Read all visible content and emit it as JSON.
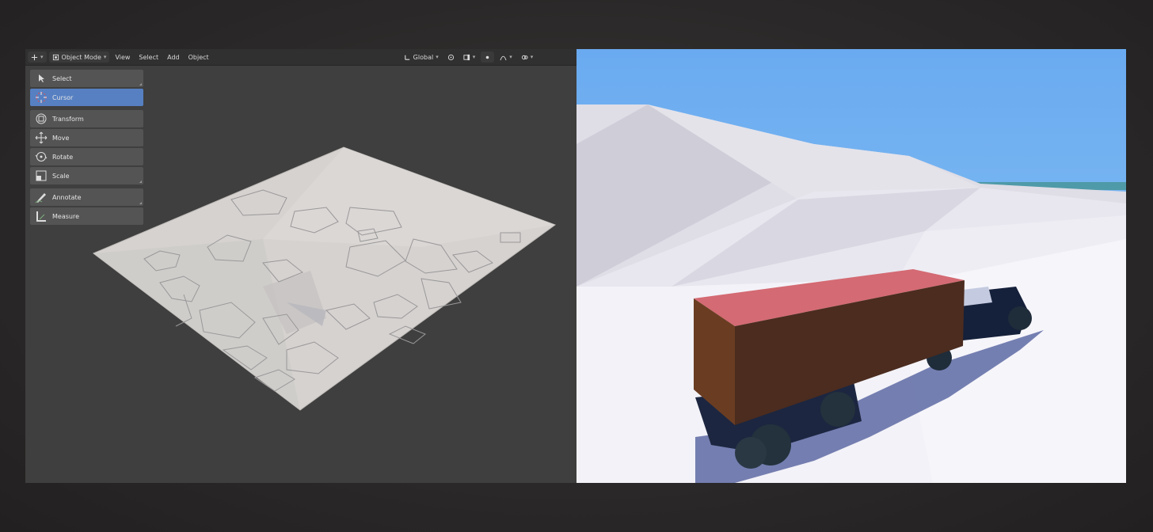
{
  "header": {
    "mode_label": "Object Mode",
    "menu": [
      "View",
      "Select",
      "Add",
      "Object"
    ],
    "orientation_label": "Global"
  },
  "toolbar": {
    "tools": [
      {
        "label": "Select",
        "icon": "select-arrow-icon"
      },
      {
        "label": "Cursor",
        "icon": "cursor-icon",
        "active": true
      },
      {
        "label": "Transform",
        "icon": "transform-icon"
      },
      {
        "label": "Move",
        "icon": "move-icon"
      },
      {
        "label": "Rotate",
        "icon": "rotate-icon"
      },
      {
        "label": "Scale",
        "icon": "scale-icon"
      },
      {
        "label": "Annotate",
        "icon": "annotate-icon"
      },
      {
        "label": "Measure",
        "icon": "measure-icon"
      }
    ]
  },
  "colors": {
    "viewport_bg": "#3f3f3f",
    "active_tool": "#5680c2",
    "terrain": "#d7d4d2",
    "sky": "#6fb2f0",
    "snow": "#f2f1f7",
    "trailer_top": "#d46a73",
    "trailer_side": "#4b2c1f"
  }
}
